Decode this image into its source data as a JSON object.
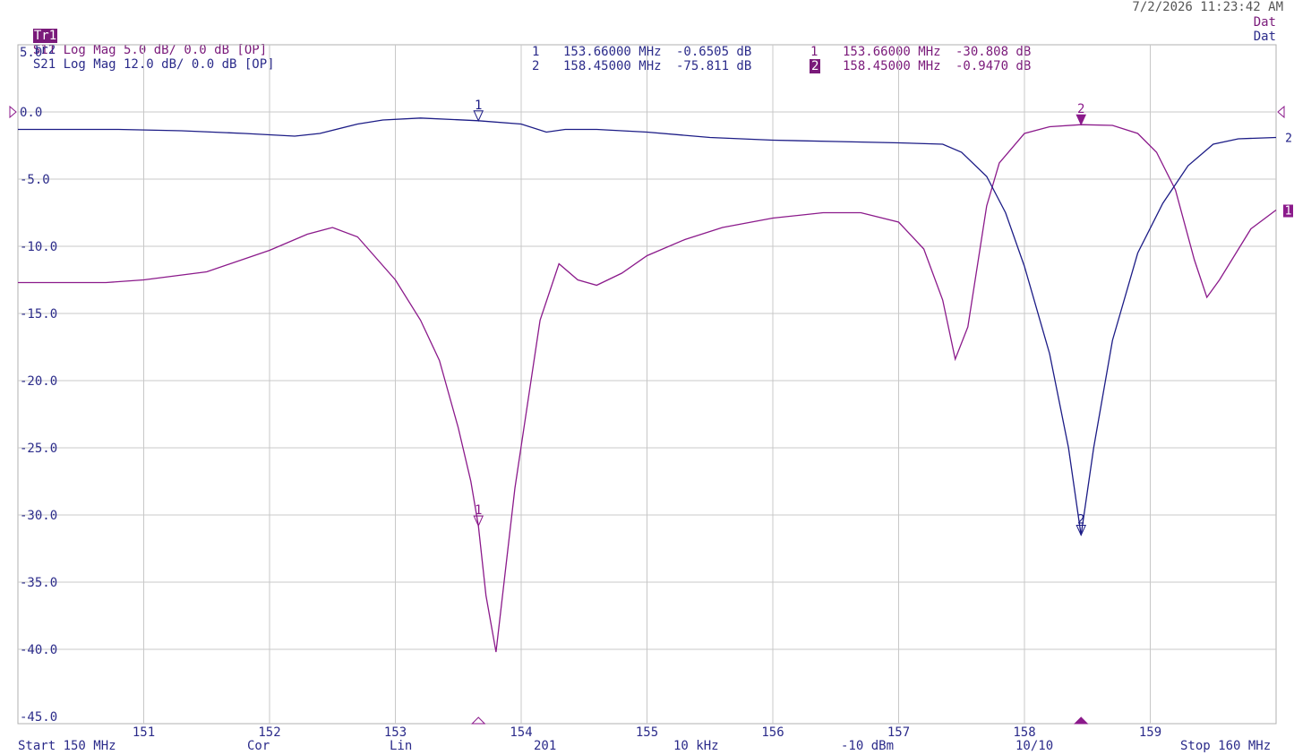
{
  "header": {
    "trace1_tag": "Tr1",
    "trace1_desc": "S11 Log Mag 5.0 dB/ 0.0 dB [OP]",
    "trace2_tag": "Tr2",
    "trace2_desc": "S21 Log Mag 12.0 dB/ 0.0 dB [OP]",
    "datetime": "7/2/2026 11:23:42 AM",
    "dat1": "Dat",
    "dat2": "Dat"
  },
  "markers_tr2": [
    {
      "id": "1",
      "freq": "153.66000 MHz",
      "value": "-0.6505 dB"
    },
    {
      "id": "2",
      "freq": "158.45000 MHz",
      "value": "-75.811 dB"
    }
  ],
  "markers_tr1": [
    {
      "id": "1",
      "freq": "153.66000 MHz",
      "value": "-30.808 dB"
    },
    {
      "id": "2",
      "freq": "158.45000 MHz",
      "value": "-0.9470 dB"
    }
  ],
  "footer": {
    "start": "Start 150 MHz",
    "cor": "Cor",
    "lin": "Lin",
    "points": "201",
    "ifbw": "10 kHz",
    "power": "-10 dBm",
    "count": "10/10",
    "stop": "Stop 160 MHz"
  },
  "colors": {
    "s11": "#8b1a8b",
    "s21": "#1c1c86",
    "grid": "#c8c8c8",
    "text": "#2b2b8a"
  },
  "chart_data": {
    "type": "line",
    "title": "",
    "xlabel": "",
    "ylabel": "",
    "xlim": [
      150,
      160
    ],
    "ylim": [
      -45,
      5
    ],
    "grid": true,
    "y_ticks": [
      "5.0",
      "0.0",
      "-5.0",
      "-10.0",
      "-15.0",
      "-20.0",
      "-25.0",
      "-30.0",
      "-35.0",
      "-40.0",
      "-45.0"
    ],
    "x_ticks": [
      "151",
      "152",
      "153",
      "154",
      "155",
      "156",
      "157",
      "158",
      "159"
    ],
    "series": [
      {
        "name": "S11",
        "end_label": "1",
        "x": [
          150.0,
          150.7,
          151.0,
          151.5,
          152.0,
          152.3,
          152.5,
          152.7,
          153.0,
          153.2,
          153.35,
          153.5,
          153.6,
          153.66,
          153.72,
          153.8,
          153.95,
          154.15,
          154.3,
          154.45,
          154.6,
          154.8,
          155.0,
          155.3,
          155.6,
          156.0,
          156.4,
          156.7,
          157.0,
          157.2,
          157.35,
          157.45,
          157.55,
          157.7,
          157.8,
          158.0,
          158.2,
          158.45,
          158.7,
          158.9,
          159.05,
          159.2,
          159.35,
          159.45,
          159.55,
          159.8,
          160.0
        ],
        "y": [
          -12.7,
          -12.7,
          -12.5,
          -11.9,
          -10.3,
          -9.1,
          -8.6,
          -9.3,
          -12.5,
          -15.5,
          -18.5,
          -23.5,
          -27.5,
          -30.8,
          -36.0,
          -40.2,
          -28.0,
          -15.5,
          -11.3,
          -12.5,
          -12.9,
          -12.0,
          -10.7,
          -9.5,
          -8.6,
          -7.9,
          -7.5,
          -7.5,
          -8.2,
          -10.2,
          -14.0,
          -18.4,
          -16.0,
          -7.0,
          -3.8,
          -1.6,
          -1.1,
          -0.947,
          -1.0,
          -1.6,
          -3.0,
          -5.8,
          -11.0,
          -13.8,
          -12.5,
          -8.7,
          -7.3
        ]
      },
      {
        "name": "S21",
        "end_label": "2",
        "x": [
          150.0,
          150.8,
          151.3,
          151.8,
          152.2,
          152.4,
          152.7,
          152.9,
          153.2,
          153.66,
          154.0,
          154.2,
          154.35,
          154.6,
          155.0,
          155.5,
          156.0,
          156.5,
          157.0,
          157.35,
          157.5,
          157.7,
          157.85,
          158.0,
          158.2,
          158.35,
          158.45,
          158.55,
          158.7,
          158.9,
          159.1,
          159.3,
          159.5,
          159.7,
          160.0
        ],
        "y": [
          -1.3,
          -1.3,
          -1.4,
          -1.6,
          -1.8,
          -1.6,
          -0.9,
          -0.6,
          -0.45,
          -0.65,
          -0.9,
          -1.5,
          -1.3,
          -1.3,
          -1.5,
          -1.9,
          -2.1,
          -2.2,
          -2.3,
          -2.4,
          -3.0,
          -4.8,
          -7.5,
          -11.5,
          -18.0,
          -25.0,
          -31.5,
          -25.0,
          -17.0,
          -10.5,
          -6.8,
          -4.0,
          -2.4,
          -2.0,
          -1.9
        ]
      }
    ],
    "markers": [
      {
        "trace": "S11",
        "id": "1",
        "x": 153.66,
        "y": -30.808,
        "active": false
      },
      {
        "trace": "S11",
        "id": "2",
        "x": 158.45,
        "y": -0.947,
        "active": true
      },
      {
        "trace": "S21",
        "id": "1",
        "x": 153.66,
        "y": -0.6505,
        "active": false
      },
      {
        "trace": "S21",
        "id": "2",
        "x": 158.45,
        "y": -31.5,
        "active": false
      }
    ]
  }
}
